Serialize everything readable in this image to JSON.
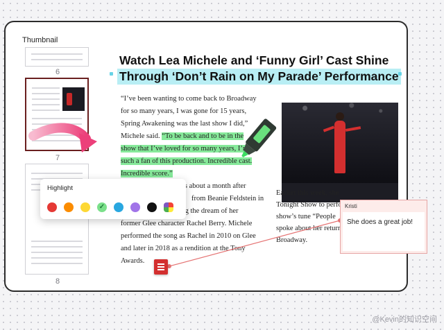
{
  "sidebar": {
    "title": "Thumbnail",
    "pages": [
      "6",
      "7",
      "8"
    ]
  },
  "article": {
    "title_line1": "Watch Lea Michele and ‘Funny Girl’ Cast Shine",
    "title_line2": "Through ‘Don’t Rain on My Parade’ Performance",
    "body_lines": [
      "“I’ve been wanting to come back to Broadway",
      "for so many years, I was gone for 15 years,",
      "Spring Awakening was the last show I did,”",
      "Michele said. “To be back and to be in the",
      "show that I’ve loved for so many years, I’m",
      "such a fan of this production. Incredible cast.",
      "Incredible score.”",
      "nes about a month after",
      "from Beanie Feldstein in",
      "early September, living the dream of her",
      "former Glee character Rachel Berry. Michele",
      "performed the song as Rachel in 2010 on Glee",
      "and later in 2018 as a rendition at the Tony",
      "Awards."
    ],
    "right_lines": [
      "Earlier this week, she",
      "Tonight Show to perform",
      "show’s tune “People",
      "spoke about her return to",
      "Broadway."
    ]
  },
  "highlight_panel": {
    "title": "Highlight",
    "colors": [
      {
        "name": "red",
        "hex": "#e53935"
      },
      {
        "name": "orange",
        "hex": "#fb8c00"
      },
      {
        "name": "yellow",
        "hex": "#fdd835"
      },
      {
        "name": "green",
        "hex": "#7be08a",
        "selected": true
      },
      {
        "name": "blue",
        "hex": "#29a7e0"
      },
      {
        "name": "purple",
        "hex": "#a174e8"
      },
      {
        "name": "black",
        "hex": "#111111"
      },
      {
        "name": "multicolor",
        "hex": "#7e57c2"
      }
    ]
  },
  "comment": {
    "author": "Kristi",
    "text": "She does a great job!"
  },
  "watermark": "@Kevin的知识空间",
  "colors": {
    "title_highlight": "#b8eef4",
    "text_highlight": "#86e99a",
    "accent_red": "#d32f2f",
    "arrow_pink": "#f06292"
  }
}
